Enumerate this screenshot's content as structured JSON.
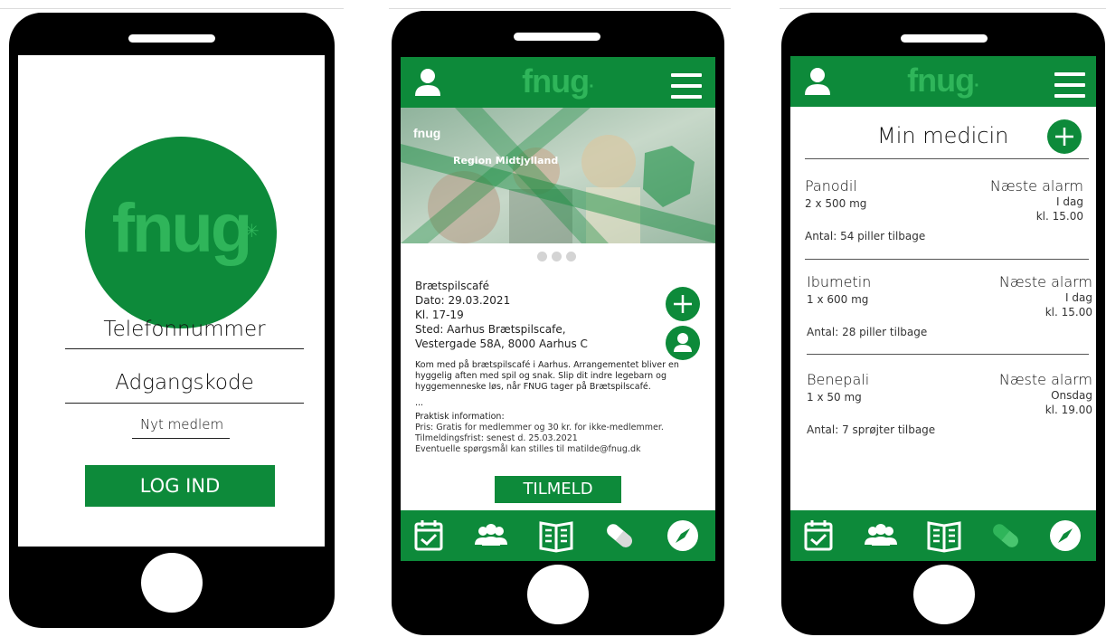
{
  "login": {
    "logo": "fnug",
    "phone_label": "Telefonnummer",
    "password_label": "Adgangskode",
    "new_member": "Nyt medlem",
    "login_button": "LOG IND"
  },
  "header": {
    "brand": "fnug",
    "brand_dot": "·"
  },
  "event": {
    "banner_brand": "fnug",
    "banner_region": "Region Midtjylland",
    "title": "Brætspilscafé",
    "date": "Dato: 29.03.2021",
    "time": "Kl. 17-19",
    "place_line1": "Sted: Aarhus Brætspilscafe,",
    "place_line2": "Vestergade 58A, 8000 Aarhus C",
    "description": "Kom med på brætspilscafé i Aarhus. Arrangementet bliver en hyggelig aften med spil og snak. Slip dit indre legebarn og hyggemenneske løs, når FNUG tager på Brætspilscafé.",
    "ellipsis": "...",
    "practical_heading": "Praktisk information:",
    "price": "Pris: Gratis for medlemmer og 30 kr. for ikke-medlemmer.",
    "deadline": "Tilmeldingsfrist: senest d. 25.03.2021",
    "questions": "Eventuelle spørgsmål kan stilles til matilde@fnug.dk",
    "signup_button": "TILMELD"
  },
  "medicine": {
    "title": "Min medicin",
    "items": [
      {
        "name": "Panodil",
        "dose": "2 x 500 mg",
        "alarm_label": "Næste alarm",
        "day": "I dag",
        "time": "kl. 15.00",
        "count_prefix": "Antal: ",
        "count": "54",
        "count_suffix": " piller tilbage"
      },
      {
        "name": "Ibumetin",
        "dose": "1 x 600 mg",
        "alarm_label": "Næste alarm",
        "day": "I dag",
        "time": "kl. 15.00",
        "count_text": "Antal: 28 piller tilbage"
      },
      {
        "name": "Benepali",
        "dose": "1 x 50 mg",
        "alarm_label": "Næste alarm",
        "day": "Onsdag",
        "time": "kl. 19.00",
        "count_text": "Antal: 7 sprøjter tilbage"
      }
    ]
  },
  "icons": {
    "profile": "person-icon",
    "menu": "hamburger-menu-icon",
    "calendar": "calendar-check-icon",
    "community": "group-icon",
    "articles": "book-icon",
    "medicine": "pill-icon",
    "explore": "compass-icon",
    "add": "plus-icon"
  },
  "colors": {
    "brand_green": "#0d8a3a",
    "logo_green": "#2fb55a"
  }
}
